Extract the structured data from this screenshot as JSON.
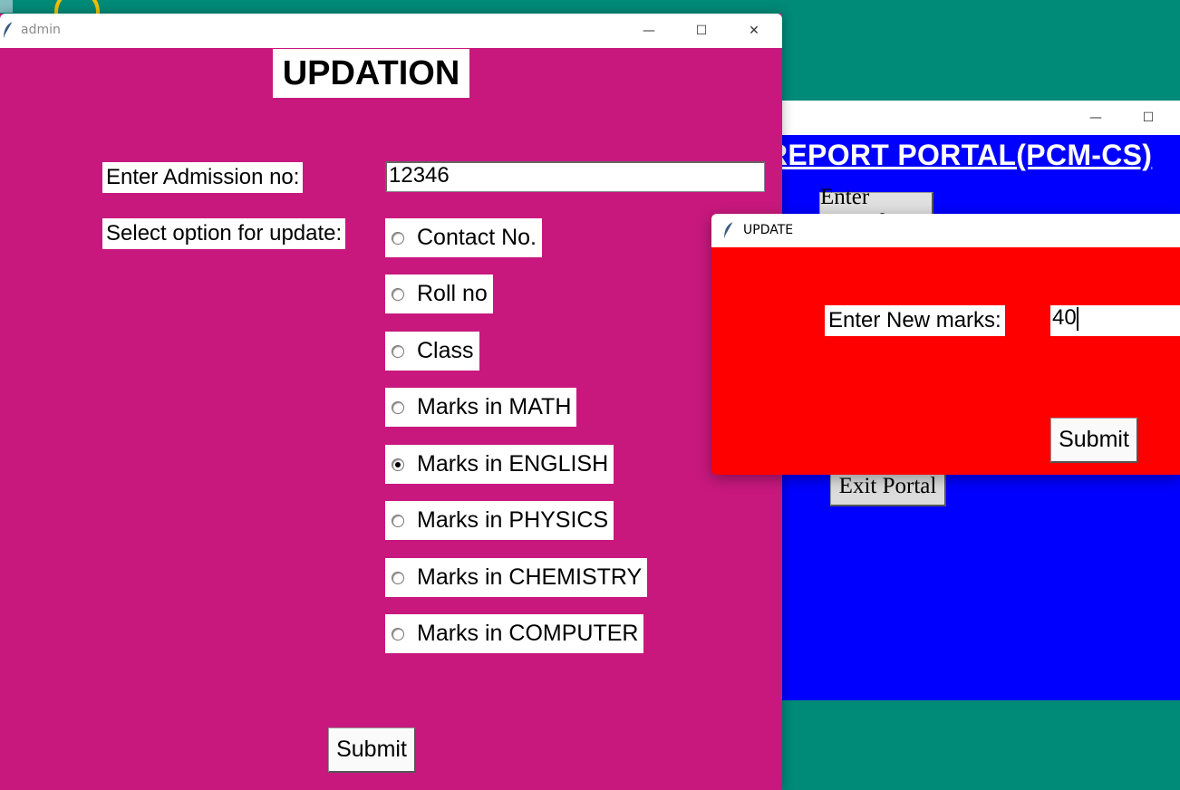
{
  "desktop": {
    "background": "#008a78"
  },
  "admin_window": {
    "title": "admin",
    "background": "#c8187e",
    "heading": "UPDATION",
    "admission_label": "Enter Admission no:",
    "admission_value": "12346",
    "select_label": "Select option for update:",
    "options": [
      {
        "label": "Contact No.",
        "selected": false
      },
      {
        "label": "Roll no",
        "selected": false
      },
      {
        "label": "Class",
        "selected": false
      },
      {
        "label": "Marks in MATH",
        "selected": false
      },
      {
        "label": "Marks in ENGLISH",
        "selected": true
      },
      {
        "label": "Marks in PHYSICS",
        "selected": false
      },
      {
        "label": "Marks in CHEMISTRY",
        "selected": false
      },
      {
        "label": "Marks in COMPUTER",
        "selected": false
      }
    ],
    "submit_label": "Submit",
    "controls": {
      "minimize": "—",
      "maximize": "☐",
      "close": "✕"
    }
  },
  "portal_window": {
    "background": "#0000ff",
    "heading": "REPORT PORTAL(PCM-CS)",
    "enter_record_label": "Enter Record",
    "exit_label": "Exit Portal",
    "controls": {
      "minimize": "—",
      "maximize": "☐"
    }
  },
  "update_window": {
    "title": "UPDATE",
    "background": "#ff0000",
    "marks_label": "Enter New marks:",
    "marks_value": "40",
    "submit_label": "Submit"
  }
}
